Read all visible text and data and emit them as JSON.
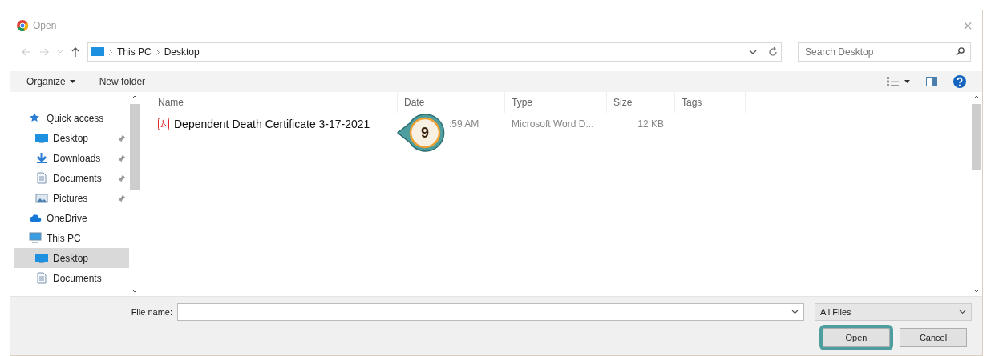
{
  "window": {
    "title": "Open",
    "close": "×"
  },
  "address": {
    "path": [
      "This PC",
      "Desktop"
    ],
    "search_placeholder": "Search Desktop"
  },
  "toolbar": {
    "organize": "Organize",
    "new_folder": "New folder"
  },
  "sidebar": {
    "items": [
      {
        "label": "Quick access",
        "kind": "star",
        "selected": false,
        "children": [
          {
            "label": "Desktop",
            "kind": "monitor",
            "pinned": true,
            "selected": false
          },
          {
            "label": "Downloads",
            "kind": "download",
            "pinned": true,
            "selected": false
          },
          {
            "label": "Documents",
            "kind": "document",
            "pinned": true,
            "selected": false
          },
          {
            "label": "Pictures",
            "kind": "picture",
            "pinned": true,
            "selected": false
          }
        ]
      },
      {
        "label": "OneDrive",
        "kind": "cloud",
        "selected": false
      },
      {
        "label": "This PC",
        "kind": "pc",
        "selected": false,
        "children": [
          {
            "label": "Desktop",
            "kind": "monitor",
            "pinned": false,
            "selected": true
          },
          {
            "label": "Documents",
            "kind": "document",
            "pinned": false,
            "selected": false
          }
        ]
      }
    ]
  },
  "table": {
    "columns": [
      "Name",
      "Date",
      "Type",
      "Size",
      "Tags"
    ],
    "rows": [
      {
        "name": "Dependent Death Certificate 3-17-2021",
        "date": ":59 AM",
        "type": "Microsoft Word D...",
        "size": "12 KB"
      }
    ]
  },
  "callout": {
    "number": "9"
  },
  "footer": {
    "file_name_label": "File name:",
    "file_type": "All Files",
    "buttons": [
      {
        "label": "Open",
        "highlighted": true
      },
      {
        "label": "Cancel",
        "highlighted": false
      }
    ]
  }
}
